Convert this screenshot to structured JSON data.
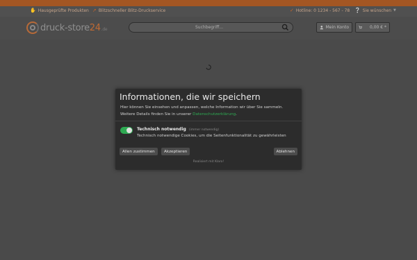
{
  "usp": [
    {
      "icon": "thumb-icon",
      "text": "Hausgeprüfte Produkten"
    },
    {
      "icon": "rocket-icon",
      "text": "Blitzschneller Blitz-Druckservice"
    },
    {
      "icon": "check-icon",
      "text": "Hotline: 0 1234 - 567 - 78"
    },
    {
      "icon": "help-icon",
      "text": "Sie wünschen"
    }
  ],
  "header": {
    "logo_main": "druck-store",
    "logo_num": "24",
    "logo_tld": ".de",
    "search_placeholder": "Suchbegriff...",
    "account_label": "Mein Konto",
    "cart_label": "0,00 € *"
  },
  "modal": {
    "title": "Informationen, die wir speichern",
    "desc_line1": "Hier können Sie einsehen und anpassen, welche Information wir über Sie sammeln.",
    "desc_line2_prefix": "Weitere Details finden Sie in unserer",
    "desc_link": "Datenschutzerklärung",
    "desc_line2_suffix": ".",
    "category": {
      "title": "Technisch notwendig",
      "subtitle": "(immer notwendig)",
      "description": "Technisch notwendige Cookies, um die Seitenfunktionalität zu gewährleisten",
      "enabled": true
    },
    "buttons": {
      "accept_all": "Allen zustimmen",
      "accept": "Akzeptieren",
      "decline": "Ablehnen"
    },
    "powered_by": "Realisiert mit Klaro!"
  },
  "colors": {
    "accent": "#c5652a",
    "toggle_on": "#2eaa52"
  }
}
